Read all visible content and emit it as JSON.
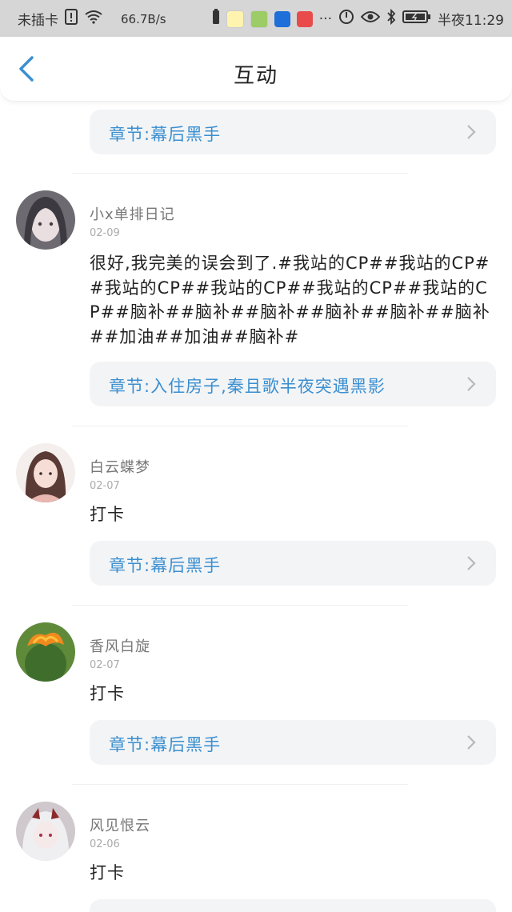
{
  "status_bar": {
    "carrier": "未插卡",
    "net_speed": "66.7B/s",
    "time": "半夜11:29",
    "more": "···"
  },
  "header": {
    "title": "互动"
  },
  "comments": [
    {
      "chapter": "章节:幕后黑手"
    },
    {
      "user": "小x单排日记",
      "date": "02-09",
      "text": "很好,我完美的误会到了.#我站的CP##我站的CP##我站的CP##我站的CP##我站的CP##我站的CP##脑补##脑补##脑补##脑补##脑补##脑补##加油##加油##脑补#",
      "chapter": "章节:入住房子,秦且歌半夜突遇黑影"
    },
    {
      "user": "白云蝶梦",
      "date": "02-07",
      "text": "打卡",
      "chapter": "章节:幕后黑手"
    },
    {
      "user": "香风白旋",
      "date": "02-07",
      "text": "打卡",
      "chapter": "章节:幕后黑手"
    },
    {
      "user": "风见恨云",
      "date": "02-06",
      "text": "打卡"
    }
  ],
  "colors": {
    "accent": "#3a8fd0",
    "status_bar_bg": "#d6d6d6",
    "chapter_bg": "#f3f4f6"
  }
}
